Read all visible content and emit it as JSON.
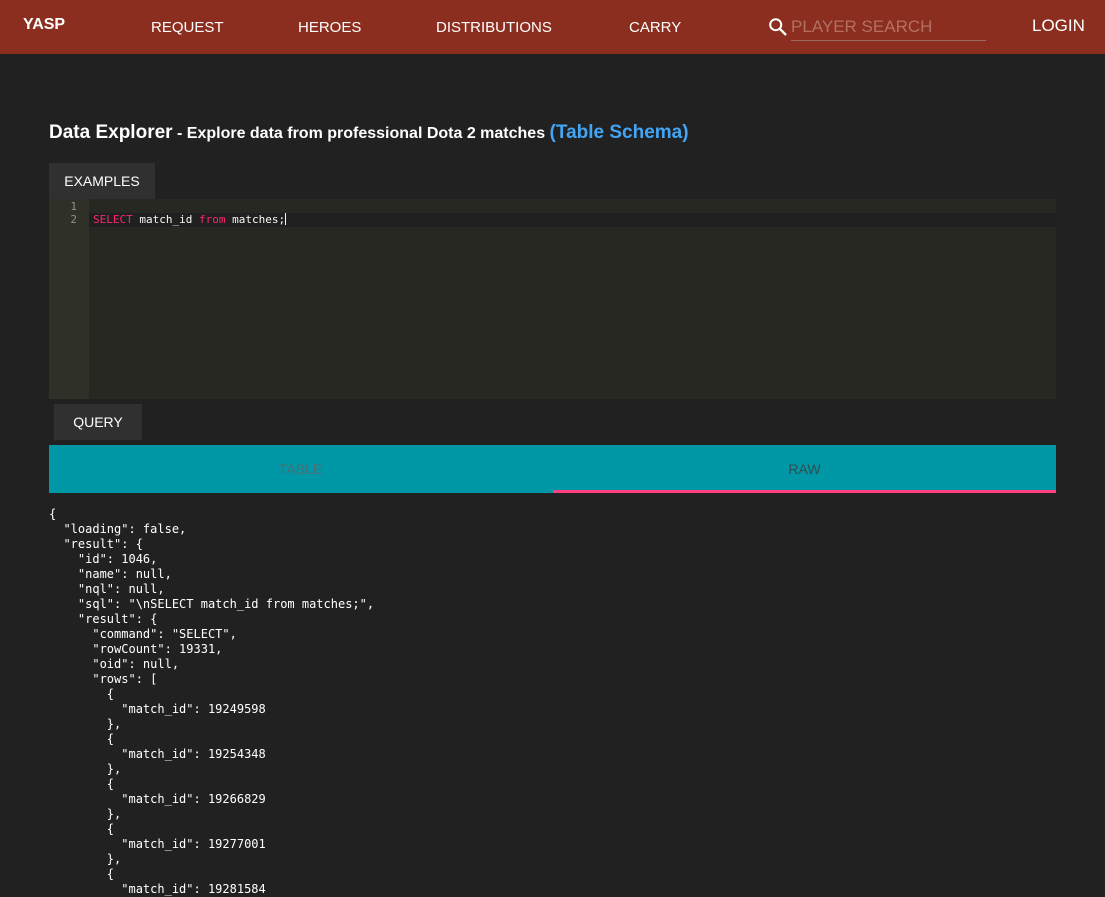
{
  "header": {
    "brand": "YASP",
    "nav": [
      "REQUEST",
      "HEROES",
      "DISTRIBUTIONS",
      "CARRY"
    ],
    "search_placeholder": "PLAYER SEARCH",
    "login": "LOGIN"
  },
  "page": {
    "title": "Data Explorer",
    "subtitle": "- Explore data from professional Dota 2 matches",
    "schema_link": "(Table Schema)"
  },
  "examples_button": "EXAMPLES",
  "editor": {
    "line_numbers": [
      "1",
      "2"
    ],
    "line2_kw1": "SELECT",
    "line2_text1": " match_id ",
    "line2_kw2": "from",
    "line2_text2": " matches;"
  },
  "query_button": "QUERY",
  "tabs": {
    "table": "TABLE",
    "raw": "RAW"
  },
  "raw_output": "{\n  \"loading\": false,\n  \"result\": {\n    \"id\": 1046,\n    \"name\": null,\n    \"nql\": null,\n    \"sql\": \"\\nSELECT match_id from matches;\",\n    \"result\": {\n      \"command\": \"SELECT\",\n      \"rowCount\": 19331,\n      \"oid\": null,\n      \"rows\": [\n        {\n          \"match_id\": 19249598\n        },\n        {\n          \"match_id\": 19254348\n        },\n        {\n          \"match_id\": 19266829\n        },\n        {\n          \"match_id\": 19277001\n        },\n        {\n          \"match_id\": 19281584"
}
